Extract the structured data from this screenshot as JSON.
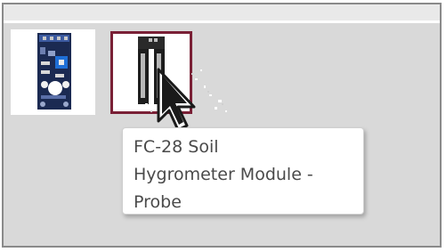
{
  "window": {
    "frame_color": "#8a8a8a"
  },
  "parts_bin": {
    "items": [
      {
        "icon": "soil-sensor-module-board-icon",
        "selected": false
      },
      {
        "icon": "soil-hygrometer-probe-icon",
        "selected": true,
        "border_color": "#7a2036"
      }
    ]
  },
  "tooltip": {
    "text": "FC-28 Soil\nHygrometer Module -\nProbe"
  },
  "cursor": {
    "icon": "arrow-cursor-icon"
  }
}
